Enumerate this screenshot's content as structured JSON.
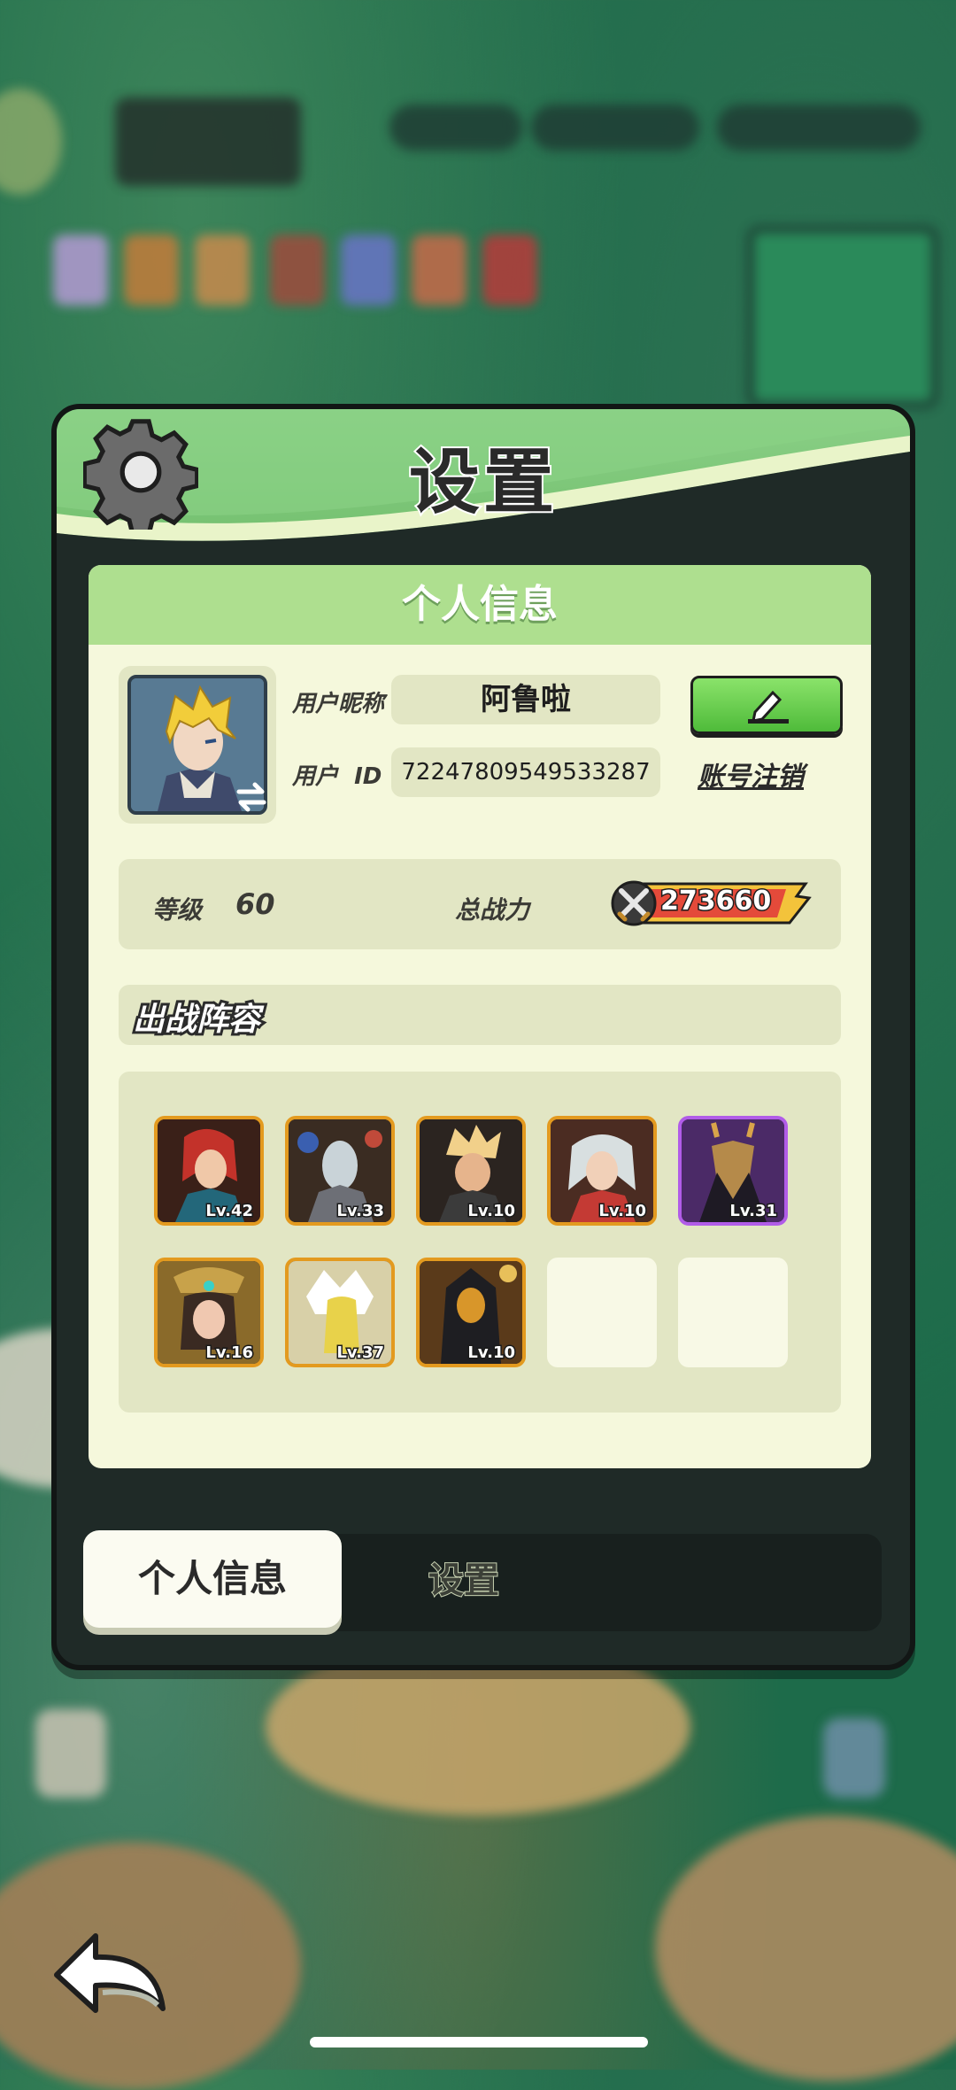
{
  "panel": {
    "title": "设置"
  },
  "profile": {
    "section_title": "个人信息",
    "nickname_label": "用户昵称",
    "nickname_value": "阿鲁啦",
    "id_label": "用户  ID",
    "id_value": "72247809549533287",
    "cancel_account_label": "账号注销",
    "level_label": "等级",
    "level_value": "60",
    "power_label": "总战力",
    "power_value": "273660"
  },
  "lineup": {
    "title": "出战阵容",
    "heroes": [
      {
        "level": "Lv.42",
        "frame": "orange"
      },
      {
        "level": "Lv.33",
        "frame": "orange"
      },
      {
        "level": "Lv.10",
        "frame": "orange"
      },
      {
        "level": "Lv.10",
        "frame": "orange"
      },
      {
        "level": "Lv.31",
        "frame": "purple"
      },
      {
        "level": "Lv.16",
        "frame": "orange"
      },
      {
        "level": "Lv.37",
        "frame": "orange"
      },
      {
        "level": "Lv.10",
        "frame": "orange"
      }
    ],
    "empty_slots": 2
  },
  "tabs": {
    "profile_tab": "个人信息",
    "settings_tab": "设置"
  },
  "colors": {
    "header_green": "#74c06f",
    "card_bg": "#f5f8dc",
    "frame_orange": "#e39a1f",
    "frame_purple": "#b15ce8",
    "edit_green": "#4fbb3a"
  },
  "icons": [
    "gear-icon",
    "pencil-icon",
    "swap-icon",
    "crossed-swords-icon",
    "back-arrow-icon"
  ]
}
